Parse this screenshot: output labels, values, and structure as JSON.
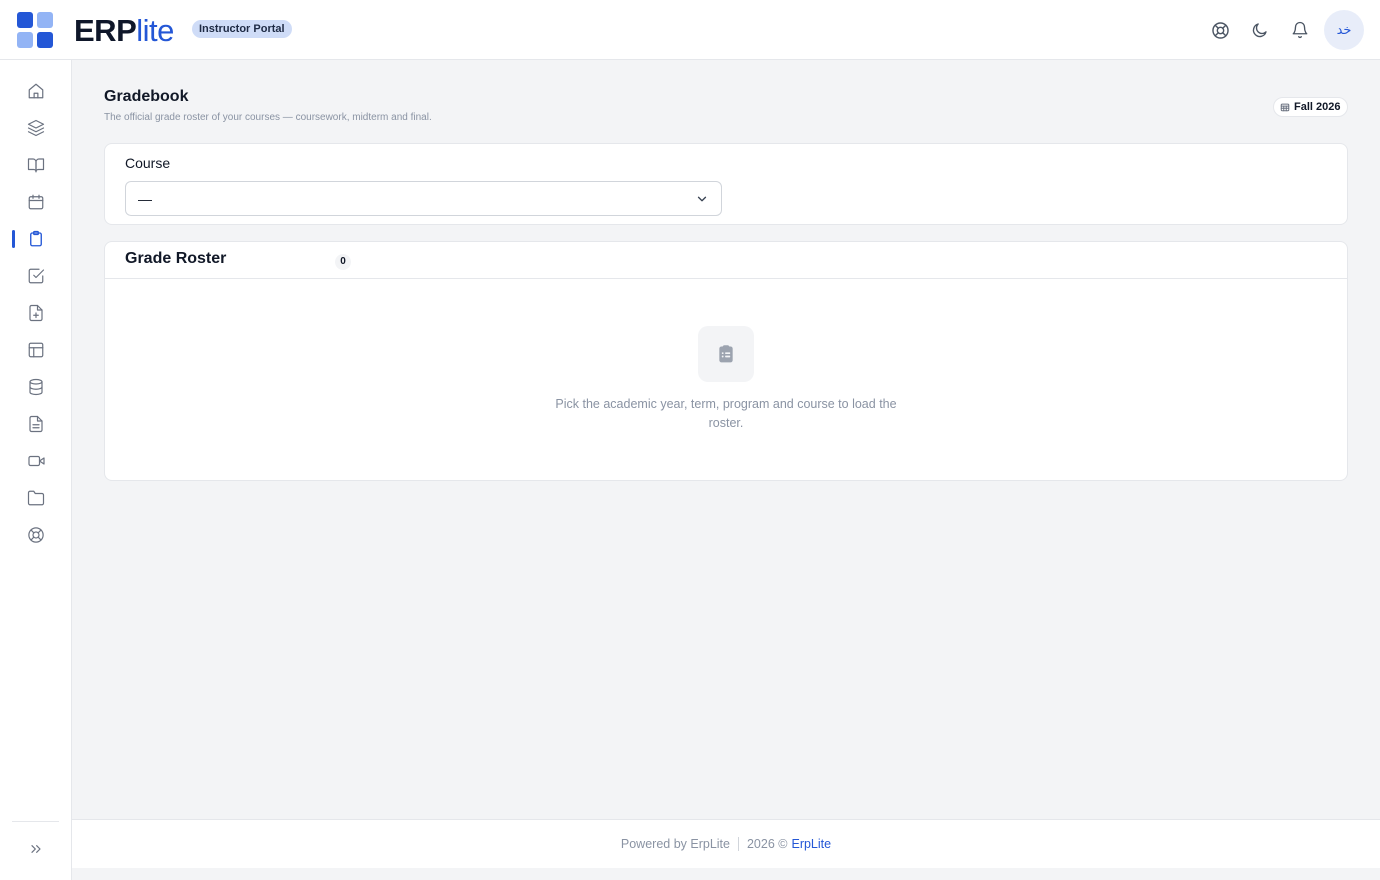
{
  "header": {
    "brand_bold": "ERP",
    "brand_light": "lite",
    "portal_badge": "Instructor Portal",
    "avatar_initials": "ﺧﺪ",
    "icons": [
      "support-icon",
      "moon-icon",
      "bell-icon"
    ]
  },
  "sidebar": {
    "items": [
      {
        "icon": "home-icon",
        "active": false
      },
      {
        "icon": "layers-icon",
        "active": false
      },
      {
        "icon": "book-open-icon",
        "active": false
      },
      {
        "icon": "calendar-icon",
        "active": false
      },
      {
        "icon": "clipboard-icon",
        "active": true
      },
      {
        "icon": "check-square-icon",
        "active": false
      },
      {
        "icon": "file-plus-icon",
        "active": false
      },
      {
        "icon": "layout-icon",
        "active": false
      },
      {
        "icon": "database-icon",
        "active": false
      },
      {
        "icon": "file-text-icon",
        "active": false
      },
      {
        "icon": "video-icon",
        "active": false
      },
      {
        "icon": "folder-icon",
        "active": false
      },
      {
        "icon": "lifebuoy-icon",
        "active": false
      }
    ],
    "collapse_icon": "chevrons-right-icon"
  },
  "page": {
    "title": "Gradebook",
    "subtitle": "The official grade roster of your courses — coursework, midterm and final.",
    "term": "Fall 2026"
  },
  "course_filter": {
    "label": "Course",
    "selected": "—"
  },
  "roster": {
    "title": "Grade Roster",
    "count": "0",
    "empty_message": "Pick the academic year, term, program and course to load the roster."
  },
  "footer": {
    "powered_by": "Powered by ErpLite",
    "copyright": "2026 ©",
    "link_text": "ErpLite"
  },
  "colors": {
    "accent": "#2457d6",
    "background": "#f3f4f6",
    "muted_text": "#8a93a3"
  }
}
